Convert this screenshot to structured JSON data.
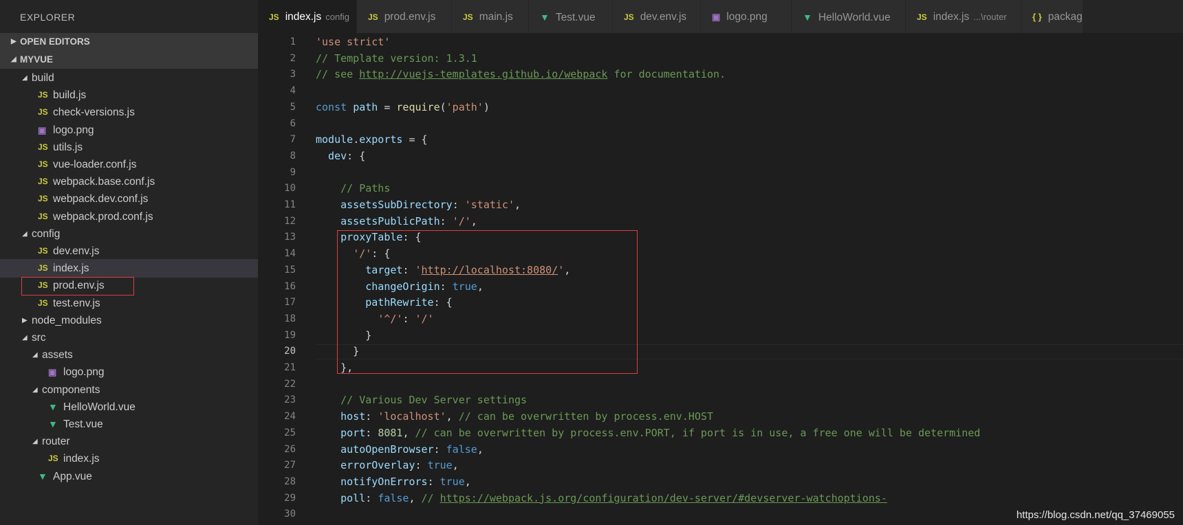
{
  "sidebar": {
    "title": "EXPLORER",
    "open_editors": "OPEN EDITORS",
    "project": "MYVUE",
    "tree": [
      {
        "label": "build",
        "type": "folder",
        "open": true,
        "depth": 0
      },
      {
        "label": "build.js",
        "type": "js",
        "depth": 1
      },
      {
        "label": "check-versions.js",
        "type": "js",
        "depth": 1
      },
      {
        "label": "logo.png",
        "type": "img",
        "depth": 1
      },
      {
        "label": "utils.js",
        "type": "js",
        "depth": 1
      },
      {
        "label": "vue-loader.conf.js",
        "type": "js",
        "depth": 1
      },
      {
        "label": "webpack.base.conf.js",
        "type": "js",
        "depth": 1
      },
      {
        "label": "webpack.dev.conf.js",
        "type": "js",
        "depth": 1
      },
      {
        "label": "webpack.prod.conf.js",
        "type": "js",
        "depth": 1
      },
      {
        "label": "config",
        "type": "folder",
        "open": true,
        "depth": 0
      },
      {
        "label": "dev.env.js",
        "type": "js",
        "depth": 1
      },
      {
        "label": "index.js",
        "type": "js",
        "depth": 1,
        "active": true
      },
      {
        "label": "prod.env.js",
        "type": "js",
        "depth": 1
      },
      {
        "label": "test.env.js",
        "type": "js",
        "depth": 1
      },
      {
        "label": "node_modules",
        "type": "folder",
        "open": false,
        "depth": 0
      },
      {
        "label": "src",
        "type": "folder",
        "open": true,
        "depth": 0
      },
      {
        "label": "assets",
        "type": "folder",
        "open": true,
        "depth": 1
      },
      {
        "label": "logo.png",
        "type": "img",
        "depth": 2
      },
      {
        "label": "components",
        "type": "folder",
        "open": true,
        "depth": 1
      },
      {
        "label": "HelloWorld.vue",
        "type": "vue",
        "depth": 2
      },
      {
        "label": "Test.vue",
        "type": "vue",
        "depth": 2
      },
      {
        "label": "router",
        "type": "folder",
        "open": true,
        "depth": 1
      },
      {
        "label": "index.js",
        "type": "js",
        "depth": 2
      },
      {
        "label": "App.vue",
        "type": "vue",
        "depth": 1
      }
    ]
  },
  "tabs": [
    {
      "label": "index.js",
      "desc": "config",
      "type": "js",
      "active": true,
      "close": "×"
    },
    {
      "label": "prod.env.js",
      "type": "js"
    },
    {
      "label": "main.js",
      "type": "js"
    },
    {
      "label": "Test.vue",
      "type": "vue"
    },
    {
      "label": "dev.env.js",
      "type": "js"
    },
    {
      "label": "logo.png",
      "type": "img"
    },
    {
      "label": "HelloWorld.vue",
      "type": "vue"
    },
    {
      "label": "index.js",
      "desc": "...\\router",
      "type": "js"
    },
    {
      "label": "packag",
      "type": "json"
    }
  ],
  "editor": {
    "current_line": 20,
    "lines": [
      [
        [
          "'use strict'",
          "str"
        ]
      ],
      [
        [
          "// Template version: 1.3.1",
          "com"
        ]
      ],
      [
        [
          "// see ",
          "com"
        ],
        [
          "http://vuejs-templates.github.io/webpack",
          "comlink"
        ],
        [
          " for documentation.",
          "com"
        ]
      ],
      [],
      [
        [
          "const",
          "kw"
        ],
        [
          " ",
          "p"
        ],
        [
          "path",
          "var"
        ],
        [
          " = ",
          "p"
        ],
        [
          "require",
          "fn"
        ],
        [
          "(",
          "p"
        ],
        [
          "'path'",
          "str"
        ],
        [
          ")",
          "p"
        ]
      ],
      [],
      [
        [
          "module",
          "var"
        ],
        [
          ".",
          "p"
        ],
        [
          "exports",
          "var"
        ],
        [
          " = {",
          "p"
        ]
      ],
      [
        [
          "  dev",
          "var"
        ],
        [
          ": {",
          "p"
        ]
      ],
      [],
      [
        [
          "    // Paths",
          "com"
        ]
      ],
      [
        [
          "    assetsSubDirectory",
          "var"
        ],
        [
          ": ",
          "p"
        ],
        [
          "'static'",
          "str"
        ],
        [
          ",",
          "p"
        ]
      ],
      [
        [
          "    assetsPublicPath",
          "var"
        ],
        [
          ": ",
          "p"
        ],
        [
          "'/'",
          "str"
        ],
        [
          ",",
          "p"
        ]
      ],
      [
        [
          "    proxyTable",
          "var"
        ],
        [
          ": {",
          "p"
        ]
      ],
      [
        [
          "      ",
          "p"
        ],
        [
          "'/'",
          "str"
        ],
        [
          ": {",
          "p"
        ]
      ],
      [
        [
          "        target",
          "var"
        ],
        [
          ": ",
          "p"
        ],
        [
          "'",
          "str"
        ],
        [
          "http://localhost:8080/",
          "strlink"
        ],
        [
          "'",
          "str"
        ],
        [
          ",",
          "p"
        ]
      ],
      [
        [
          "        changeOrigin",
          "var"
        ],
        [
          ": ",
          "p"
        ],
        [
          "true",
          "kw"
        ],
        [
          ",",
          "p"
        ]
      ],
      [
        [
          "        pathRewrite",
          "var"
        ],
        [
          ": {",
          "p"
        ]
      ],
      [
        [
          "          ",
          "p"
        ],
        [
          "'^/'",
          "str"
        ],
        [
          ": ",
          "p"
        ],
        [
          "'/'",
          "str"
        ]
      ],
      [
        [
          "        }",
          "p"
        ]
      ],
      [
        [
          "      }",
          "p"
        ]
      ],
      [
        [
          "    },",
          "p"
        ]
      ],
      [],
      [
        [
          "    // Various Dev Server settings",
          "com"
        ]
      ],
      [
        [
          "    host",
          "var"
        ],
        [
          ": ",
          "p"
        ],
        [
          "'localhost'",
          "str"
        ],
        [
          ", ",
          "p"
        ],
        [
          "// can be overwritten by process.env.HOST",
          "com"
        ]
      ],
      [
        [
          "    port",
          "var"
        ],
        [
          ": ",
          "p"
        ],
        [
          "8081",
          "num"
        ],
        [
          ", ",
          "p"
        ],
        [
          "// can be overwritten by process.env.PORT, if port is in use, a free one will be determined",
          "com"
        ]
      ],
      [
        [
          "    autoOpenBrowser",
          "var"
        ],
        [
          ": ",
          "p"
        ],
        [
          "false",
          "kw"
        ],
        [
          ",",
          "p"
        ]
      ],
      [
        [
          "    errorOverlay",
          "var"
        ],
        [
          ": ",
          "p"
        ],
        [
          "true",
          "kw"
        ],
        [
          ",",
          "p"
        ]
      ],
      [
        [
          "    notifyOnErrors",
          "var"
        ],
        [
          ": ",
          "p"
        ],
        [
          "true",
          "kw"
        ],
        [
          ",",
          "p"
        ]
      ],
      [
        [
          "    poll",
          "var"
        ],
        [
          ": ",
          "p"
        ],
        [
          "false",
          "kw"
        ],
        [
          ", ",
          "p"
        ],
        [
          "// ",
          "com"
        ],
        [
          "https://webpack.js.org/configuration/dev-server/#devserver-watchoptions-",
          "comlink"
        ]
      ],
      []
    ]
  },
  "watermark": "https://blog.csdn.net/qq_37469055"
}
